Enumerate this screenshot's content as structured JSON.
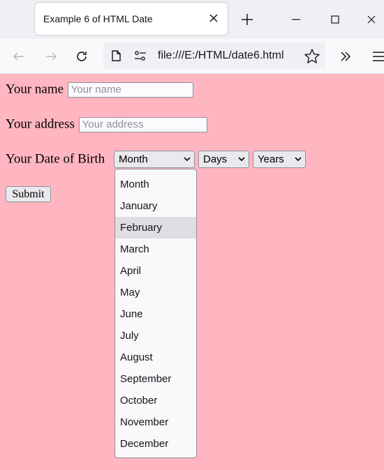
{
  "browser": {
    "tab_title": "Example 6 of HTML Date",
    "url": "file:///E:/HTML/date6.html"
  },
  "form": {
    "name_label": "Your name",
    "name_placeholder": "Your name",
    "address_label": "Your address",
    "address_placeholder": "Your address",
    "dob_label": "Your Date of Birth",
    "month_value": "Month",
    "days_value": "Days",
    "years_value": "Years",
    "submit_label": "Submit"
  },
  "month_dropdown": {
    "highlighted": "February",
    "options": [
      "Month",
      "January",
      "February",
      "March",
      "April",
      "May",
      "June",
      "July",
      "August",
      "September",
      "October",
      "November",
      "December"
    ]
  },
  "colors": {
    "page_background": "#ffb6c1",
    "highlight": "#dedee3"
  }
}
